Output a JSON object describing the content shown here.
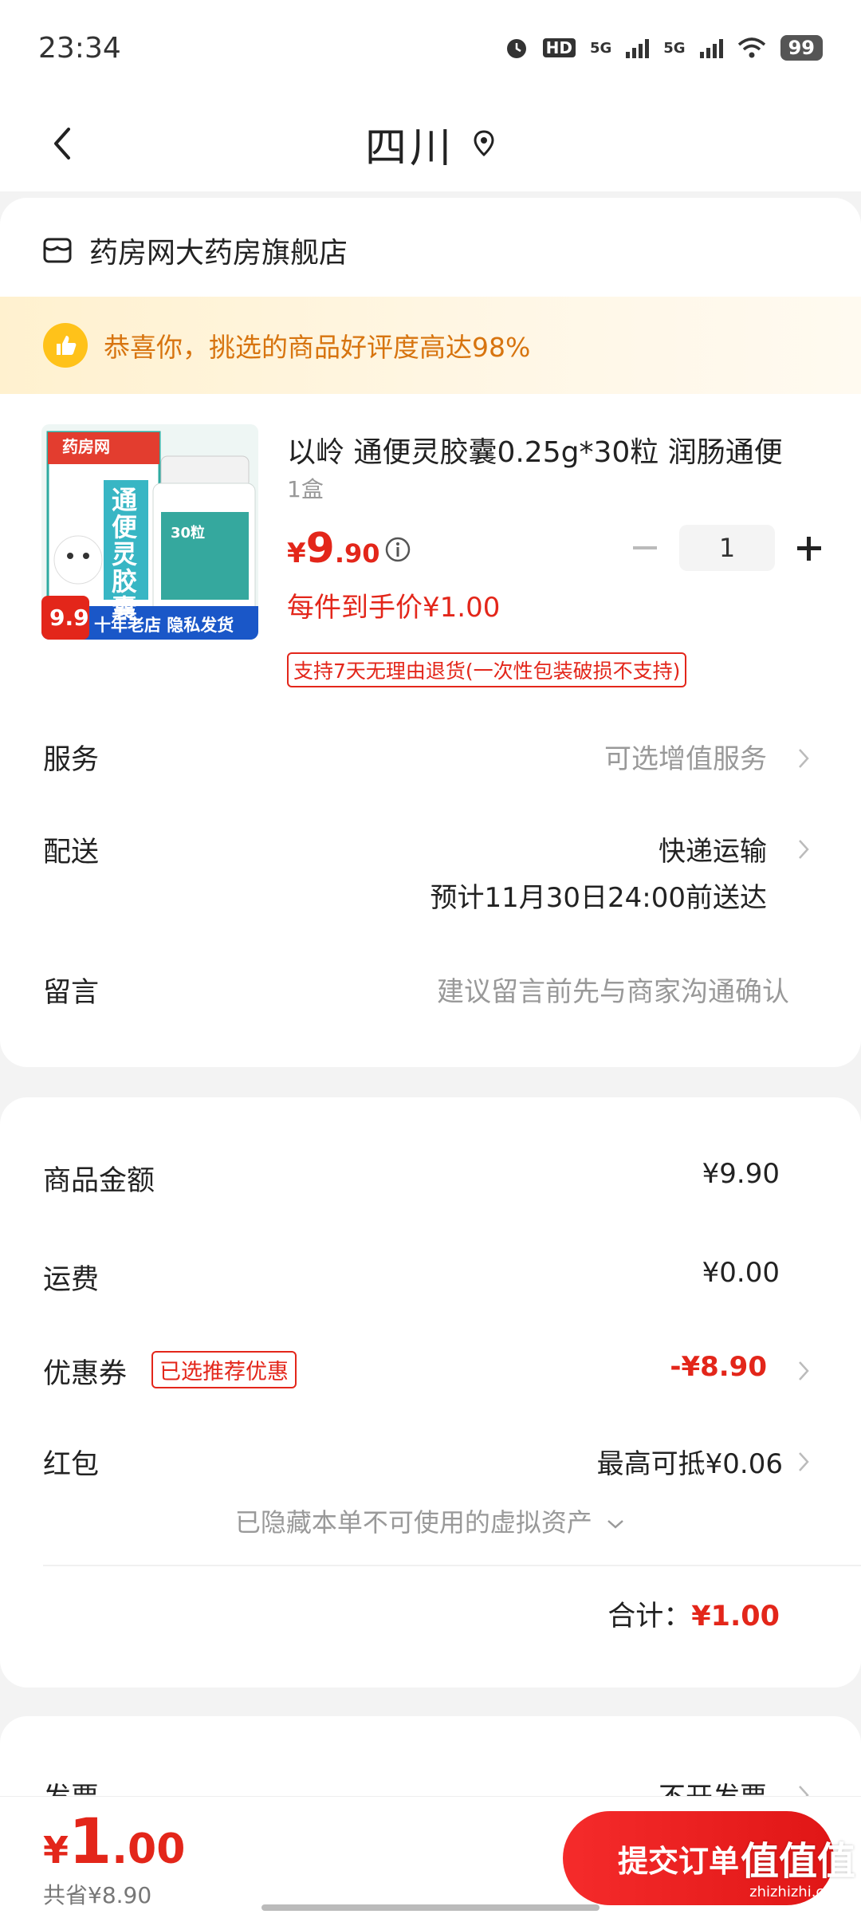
{
  "status_bar": {
    "time": "23:34",
    "hd": "HD",
    "signal1": "5G",
    "signal2": "5G",
    "battery": "99"
  },
  "nav": {
    "title": "四川"
  },
  "store": {
    "name": "药房网大药房旗舰店"
  },
  "banner": {
    "text": "恭喜你，挑选的商品好评度高达98%"
  },
  "product": {
    "title": "以岭 通便灵胶囊0.25g*30粒 润肠通便",
    "spec": "1盒",
    "price_symbol": "¥",
    "price_int": "9",
    "price_dec": ".90",
    "quantity": "1",
    "unit_price": "每件到手价¥1.00",
    "return_policy": "支持7天无理由退货(一次性包装破损不支持)",
    "image": {
      "brand": "药房网",
      "name": "通便灵胶囊",
      "count": "30粒",
      "badge_price": "9.9",
      "slogan": "十年老店 隐私发货"
    }
  },
  "rows": {
    "service": {
      "label": "服务",
      "value": "可选增值服务"
    },
    "delivery": {
      "label": "配送",
      "value": "快递运输",
      "eta": "预计11月30日24:00前送达"
    },
    "message": {
      "label": "留言",
      "placeholder": "建议留言前先与商家沟通确认"
    }
  },
  "summary": {
    "goods": {
      "label": "商品金额",
      "value": "¥9.90"
    },
    "shipping": {
      "label": "运费",
      "value": "¥0.00"
    },
    "coupon": {
      "label": "优惠券",
      "tag": "已选推荐优惠",
      "value": "-¥8.90"
    },
    "redpacket": {
      "label": "红包",
      "value": "最高可抵¥0.06"
    },
    "hidden_assets": "已隐藏本单不可使用的虚拟资产",
    "total_label": "合计：",
    "total_value": "¥1.00"
  },
  "invoice": {
    "label": "发票",
    "value": "不开发票"
  },
  "bottom": {
    "price_symbol": "¥",
    "price_int": "1",
    "price_dec": ".00",
    "saved": "共省¥8.90",
    "submit_label": "提交订单",
    "watermark": "值值值",
    "watermark_url": "zhizhizhi.com"
  },
  "colors": {
    "accent_red": "#e3261a",
    "banner_orange": "#d7740f",
    "thumb_yellow": "#ffc21a"
  }
}
